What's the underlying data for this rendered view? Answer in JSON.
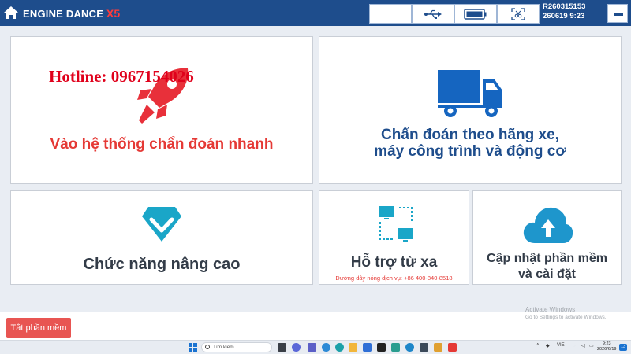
{
  "app": {
    "brand_name": "ENGINE DANCE",
    "brand_suffix": "X5",
    "serial_number": "R260315153",
    "serial_datetime": "260619 9:23",
    "accent_color": "#1e4d8c",
    "status_icons": [
      "blank-status",
      "usb-icon",
      "battery-icon",
      "screenshot-icon"
    ]
  },
  "tiles": {
    "quick_diagnosis": {
      "hotline_overlay": "Hotline: 0967154026",
      "label": "Vào hệ thống chẩn đoán nhanh",
      "icon": "rocket-icon"
    },
    "brand_diagnosis": {
      "label": "Chẩn đoán theo hãng xe,\nmáy công trình và động cơ",
      "icon": "truck-icon"
    },
    "advanced": {
      "label": "Chức năng nâng cao",
      "icon": "diamond-icon"
    },
    "remote_support": {
      "label": "Hỗ trợ từ xa",
      "hotline": "Đường dây nóng dịch vụ: +86 400-840-8518",
      "icon": "remote-network-icon"
    },
    "update": {
      "label": "Cập nhật phần mềm\nvà cài đặt",
      "icon": "cloud-upload-icon"
    }
  },
  "footer": {
    "exit_button": "Tắt phần mềm",
    "watermark_title": "Activate Windows",
    "watermark_sub": "Go to Settings to activate Windows."
  },
  "taskbar": {
    "search_placeholder": "Tìm kiếm",
    "language": "VIE",
    "time": "9:23",
    "date": "2026/6/19",
    "notification_count": "13"
  }
}
